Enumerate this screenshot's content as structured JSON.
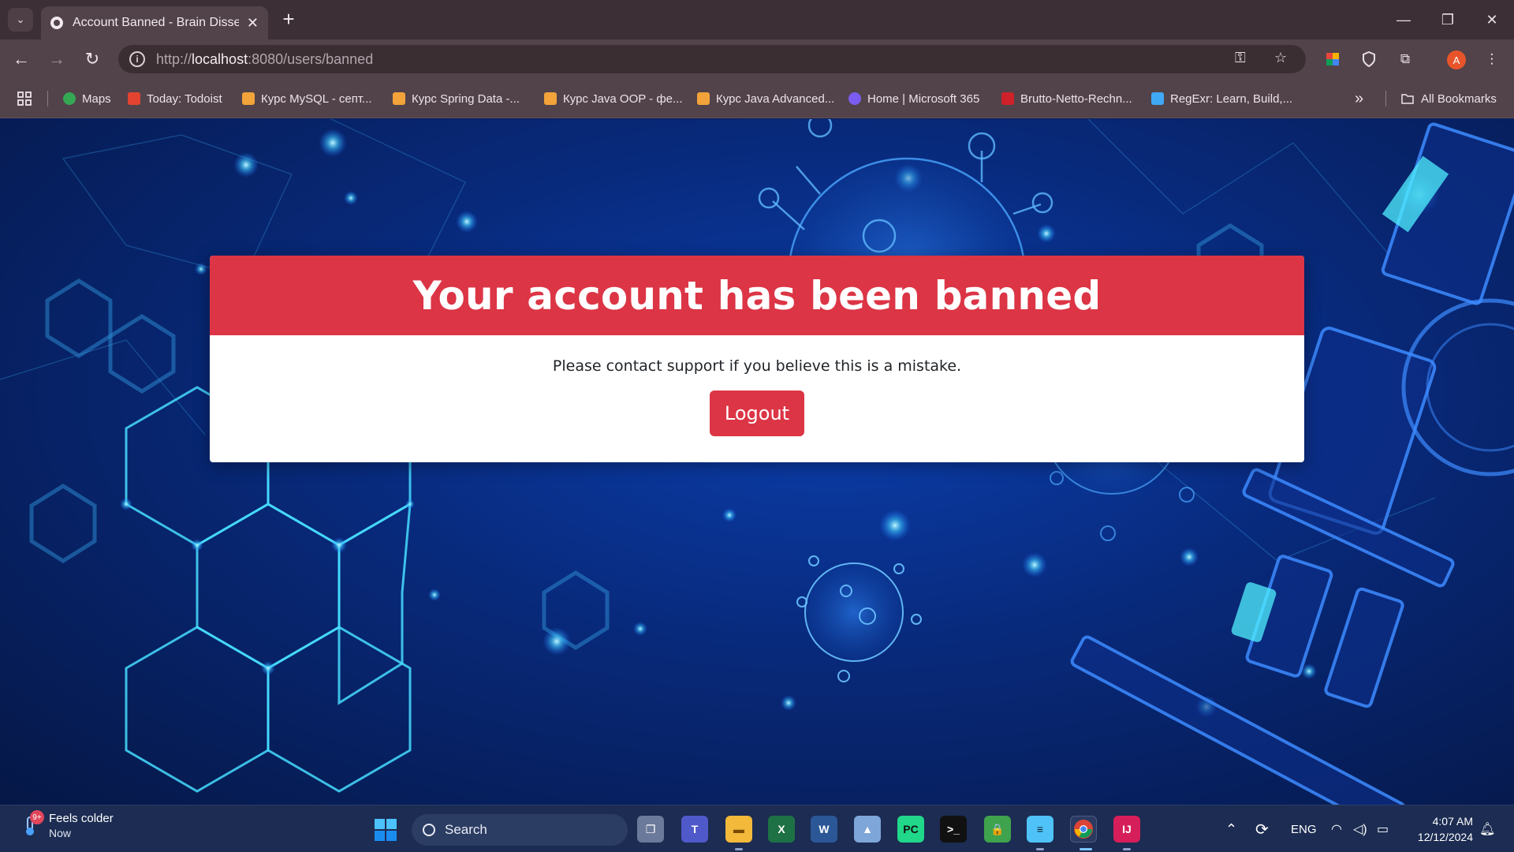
{
  "browser": {
    "tab_title": "Account Banned - Brain Dissect",
    "tab_close": "✕",
    "new_tab": "+",
    "url_prefix": "http://",
    "url_host": "localhost",
    "url_rest": ":8080/users/banned",
    "window_controls": {
      "minimize": "—",
      "restore": "❐",
      "close": "✕"
    }
  },
  "bookmarks": [
    {
      "label": "Maps",
      "icon": "maps-icon",
      "color": "#34a853"
    },
    {
      "label": "Today: Todoist",
      "icon": "todoist-icon",
      "color": "#e44332"
    },
    {
      "label": "Курс MySQL - септ...",
      "icon": "course-icon",
      "color": "#f2a33a"
    },
    {
      "label": "Курс Spring Data -...",
      "icon": "course-icon",
      "color": "#f2a33a"
    },
    {
      "label": "Курс Java OOP - фе...",
      "icon": "course-icon",
      "color": "#f2a33a"
    },
    {
      "label": "Курс Java Advanced...",
      "icon": "course-icon",
      "color": "#f2a33a"
    },
    {
      "label": "Home | Microsoft 365",
      "icon": "microsoft365-icon",
      "color": "#7b5cf0"
    },
    {
      "label": "Brutto-Netto-Rechn...",
      "icon": "brutto-netto-icon",
      "color": "#d0202a"
    },
    {
      "label": "RegExr: Learn, Build,...",
      "icon": "regexr-icon",
      "color": "#3fa9f5"
    }
  ],
  "bookmarks_more": "»",
  "all_bookmarks": "All Bookmarks",
  "profile_initial": "A",
  "card": {
    "title": "Your account has been banned",
    "message": "Please contact support if you believe this is a mistake.",
    "button": "Logout",
    "accent": "#dc3545"
  },
  "taskbar": {
    "weather_title": "Feels colder",
    "weather_sub": "Now",
    "weather_badge": "9+",
    "search_label": "Search",
    "language": "ENG",
    "time": "4:07 AM",
    "date": "12/12/2024"
  }
}
